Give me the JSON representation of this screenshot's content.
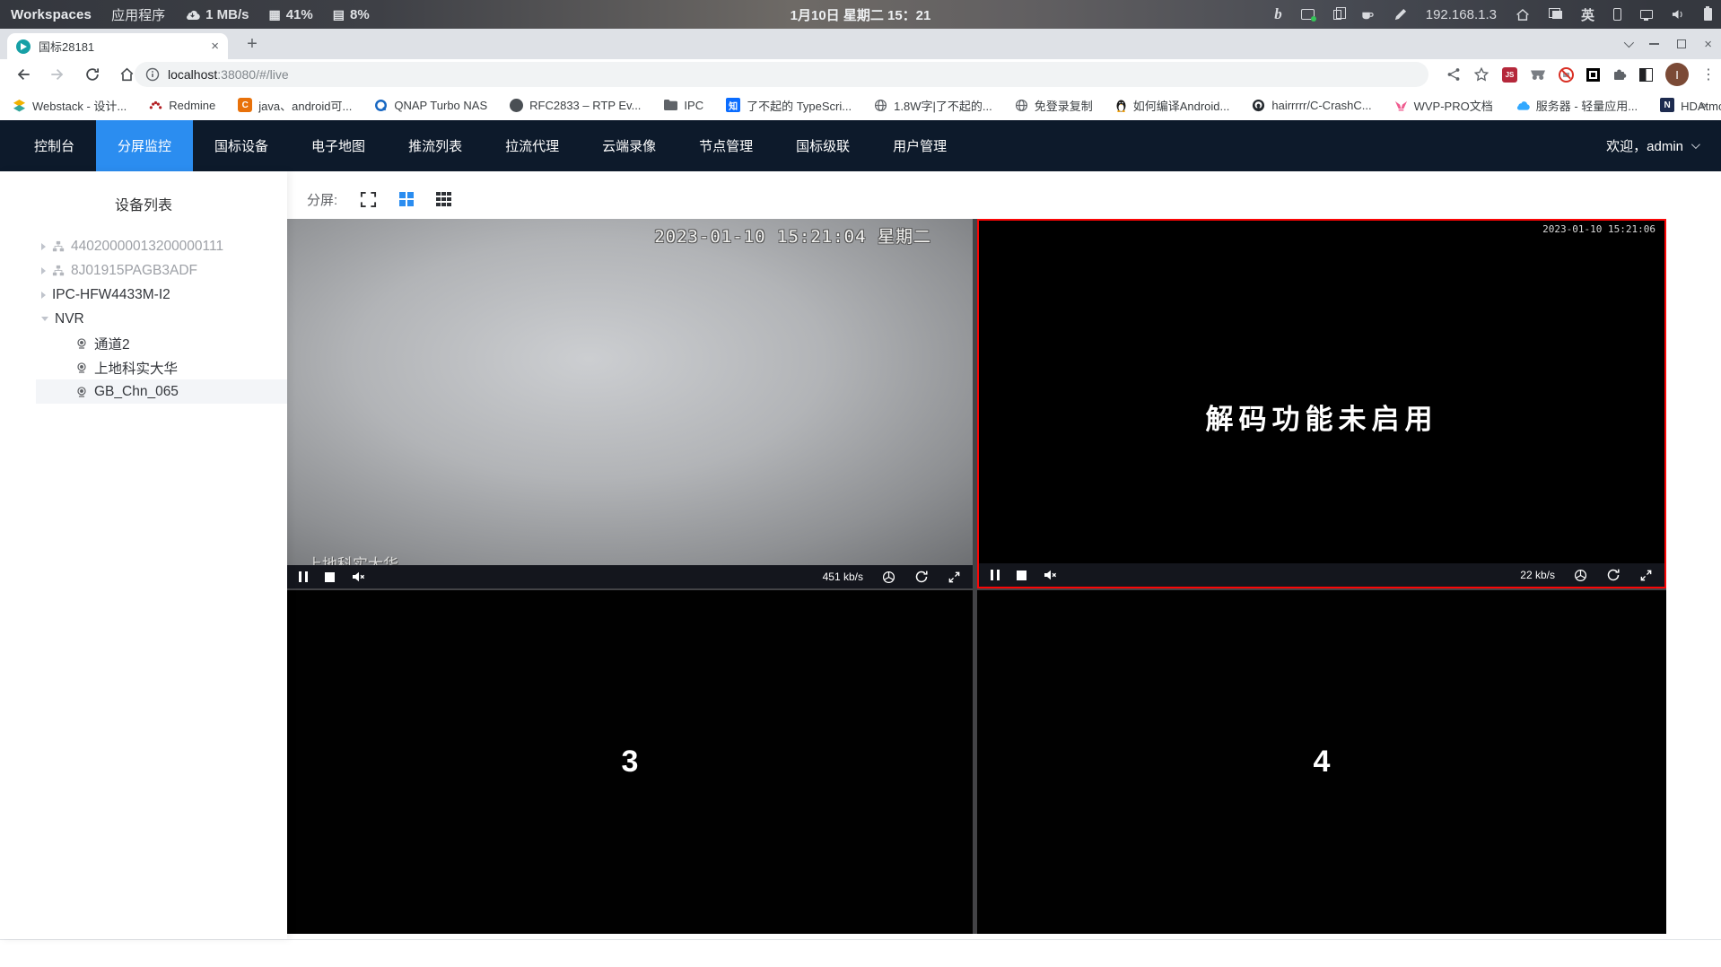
{
  "panel": {
    "workspaces": "Workspaces",
    "apps_label": "应用程序",
    "net": "1 MB/s",
    "cpu": "41%",
    "mem": "8%",
    "clock": "1月10日 星期二 15：21",
    "bing": "b",
    "ip": "192.168.1.3",
    "ime": "英"
  },
  "browser": {
    "tab_title": "国标28181",
    "url_host": "localhost",
    "url_rest": ":38080/#/live",
    "js_badge": "JS",
    "avatar": "I",
    "overflow": "»",
    "bookmarks": [
      {
        "label": "Webstack - 设计...",
        "icon": "layers-icon"
      },
      {
        "label": "Redmine",
        "icon": "redmine-icon"
      },
      {
        "label": "java、android可...",
        "icon": "c-badge-icon",
        "badge": "C"
      },
      {
        "label": "QNAP Turbo NAS",
        "icon": "qnap-icon"
      },
      {
        "label": "RFC2833 – RTP Ev...",
        "icon": "dark-globe-icon"
      },
      {
        "label": "IPC",
        "icon": "folder-icon"
      },
      {
        "label": "了不起的 TypeScri...",
        "icon": "zhihu-icon",
        "badge": "知"
      },
      {
        "label": "1.8W字|了不起的...",
        "icon": "globe-icon"
      },
      {
        "label": "免登录复制",
        "icon": "globe-icon"
      },
      {
        "label": "如何编译Android...",
        "icon": "penguin-icon"
      },
      {
        "label": "hairrrrr/C-CrashC...",
        "icon": "github-icon"
      },
      {
        "label": "WVP-PRO文档",
        "icon": "wvp-icon"
      },
      {
        "label": "服务器 - 轻量应用...",
        "icon": "cloud-icon"
      },
      {
        "label": "HDAtmos :: 种子 *...",
        "icon": "n-badge-icon",
        "badge": "N"
      }
    ]
  },
  "nav": {
    "items": [
      {
        "label": "控制台"
      },
      {
        "label": "分屏监控",
        "active": true
      },
      {
        "label": "国标设备"
      },
      {
        "label": "电子地图"
      },
      {
        "label": "推流列表"
      },
      {
        "label": "拉流代理"
      },
      {
        "label": "云端录像"
      },
      {
        "label": "节点管理"
      },
      {
        "label": "国标级联"
      },
      {
        "label": "用户管理"
      }
    ],
    "welcome": "欢迎，admin"
  },
  "sidebar": {
    "title": "设备列表",
    "nodes": [
      {
        "label": "44020000013200000111",
        "muted": true,
        "expanded": false
      },
      {
        "label": "8J01915PAGB3ADF",
        "muted": true,
        "expanded": false
      },
      {
        "label": "IPC-HFW4433M-I2",
        "muted": false,
        "expanded": false
      },
      {
        "label": "NVR",
        "muted": false,
        "expanded": true
      }
    ],
    "children": [
      {
        "label": "通道2",
        "selected": false
      },
      {
        "label": "上地科实大华",
        "selected": false
      },
      {
        "label": "GB_Chn_065",
        "selected": true
      }
    ]
  },
  "screen_toolbar": {
    "split_label": "分屏:"
  },
  "videos": {
    "v1": {
      "osd_time": "2023-01-10 15:21:04 星期二",
      "name": "上地科实大华",
      "bitrate": "451 kb/s"
    },
    "v2": {
      "osd_time": "2023-01-10 15:21:06",
      "message": "解码功能未启用",
      "bitrate": "22 kb/s"
    },
    "v3": {
      "number": "3"
    },
    "v4": {
      "number": "4"
    }
  },
  "colors": {
    "accent_blue": "#2b8df0",
    "nav_bg": "#0d1a2b",
    "selected_cell_border": "#fb0606",
    "tab_strip": "#dee1e6",
    "favicon_teal": "#17a0a6"
  }
}
